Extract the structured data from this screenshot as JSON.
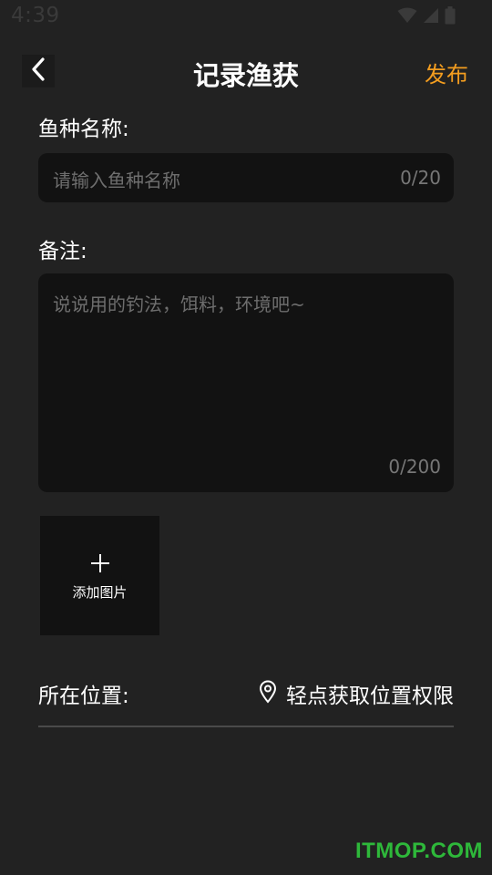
{
  "status_bar": {
    "time": "4:39",
    "icons": [
      "wifi-icon",
      "cell-signal-icon",
      "battery-icon"
    ]
  },
  "header": {
    "back_icon": "chevron-left-icon",
    "title": "记录渔获",
    "publish_label": "发布"
  },
  "fish_name": {
    "label": "鱼种名称:",
    "placeholder": "请输入鱼种名称",
    "value": "",
    "counter": "0/20"
  },
  "remarks": {
    "label": "备注:",
    "placeholder": "说说用的钓法，饵料，环境吧~",
    "value": "",
    "counter": "0/200"
  },
  "add_image": {
    "icon": "plus-icon",
    "label": "添加图片"
  },
  "location": {
    "label": "所在位置:",
    "icon": "location-pin-icon",
    "action_label": "轻点获取位置权限"
  },
  "colors": {
    "background": "#222222",
    "input_background": "#121212",
    "accent": "#f39d1f",
    "placeholder": "#6e6e6e",
    "watermark": "#2eb83a"
  },
  "watermark": "ITMOP.COM"
}
